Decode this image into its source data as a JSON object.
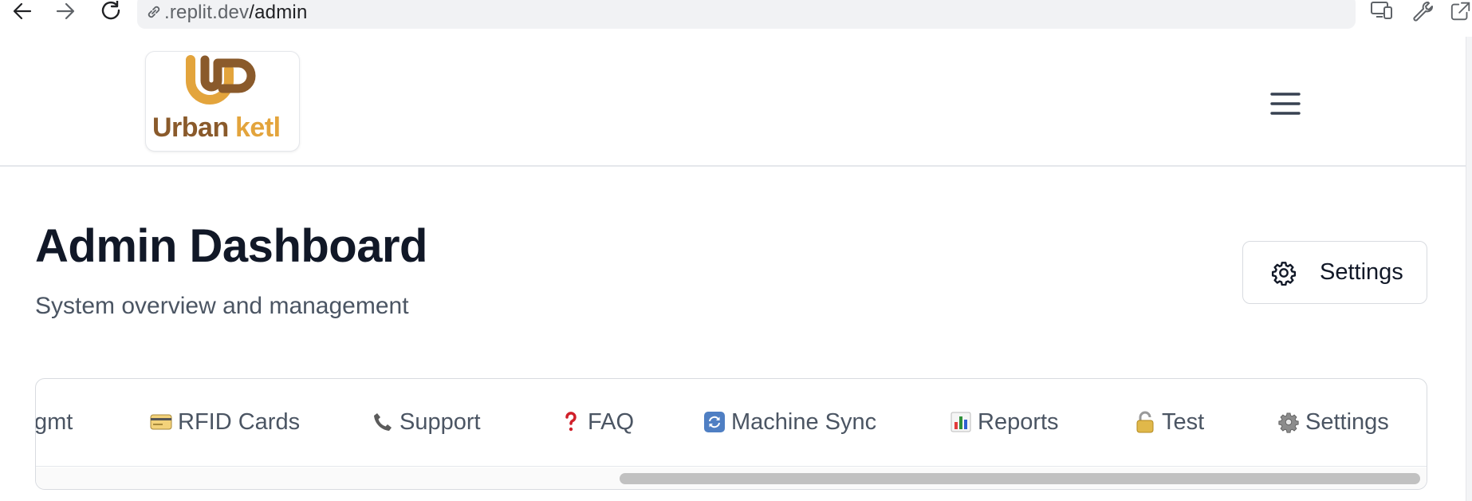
{
  "browser": {
    "url_host": ".replit.dev",
    "url_path": "/admin"
  },
  "header": {
    "logo_text": "Urban ketl",
    "logo_colors": {
      "brown": "#8a5a2b",
      "gold": "#e3a43c"
    }
  },
  "page": {
    "title": "Admin Dashboard",
    "subtitle": "System overview and management",
    "settings_button_label": "Settings"
  },
  "tabs": [
    {
      "label": "gmt",
      "icon": ""
    },
    {
      "label": "RFID Cards",
      "icon": "credit-card-icon"
    },
    {
      "label": "Support",
      "icon": "telephone-icon"
    },
    {
      "label": "FAQ",
      "icon": "question-mark-icon"
    },
    {
      "label": "Machine Sync",
      "icon": "sync-icon"
    },
    {
      "label": "Reports",
      "icon": "bar-chart-icon"
    },
    {
      "label": "Test",
      "icon": "lock-icon"
    },
    {
      "label": "Settings",
      "icon": "gear-icon"
    }
  ]
}
